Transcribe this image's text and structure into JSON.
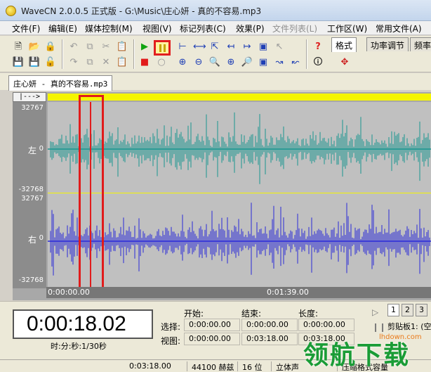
{
  "window": {
    "title": "WaveCN 2.0.0.5 正式版 - G:\\Music\\庄心妍 - 真的不容易.mp3"
  },
  "menu": [
    {
      "label": "文件(F)",
      "enabled": true
    },
    {
      "label": "编辑(E)",
      "enabled": true
    },
    {
      "label": "媒体控制(M)",
      "enabled": true
    },
    {
      "label": "视图(V)",
      "enabled": true
    },
    {
      "label": "标记列表(C)",
      "enabled": true
    },
    {
      "label": "效果(P)",
      "enabled": true
    },
    {
      "label": "文件列表(L)",
      "enabled": false
    },
    {
      "label": "工作区(W)",
      "enabled": true
    },
    {
      "label": "常用文件(A)",
      "enabled": true
    }
  ],
  "panel_tabs": [
    {
      "label": "格式",
      "active": true
    },
    {
      "label": "功率调节",
      "active": false
    },
    {
      "label": "频率"
    }
  ],
  "document_tab": "庄心妍 - 真的不容易.mp3",
  "waveform": {
    "range_button": "|--->",
    "left_channel": {
      "label": "左",
      "zero": "0",
      "max": "32767",
      "min": "-32768"
    },
    "right_channel": {
      "label": "右",
      "zero": "0",
      "max": "32767",
      "min": "-32768"
    },
    "time_start": "0:00:00.00",
    "time_mid": "0:01:39.00",
    "playhead_time": "0:00:18.02",
    "colors": {
      "left": "#1a9690",
      "right": "#2a2ad8",
      "playhead": "#e11b1b",
      "highlight": "#f5f500"
    }
  },
  "position": {
    "display": "0:00:18.02",
    "unit_label": "时:分:秒:1/30秒"
  },
  "selection": {
    "headers": {
      "start": "开始:",
      "end": "结束:",
      "length": "长度:"
    },
    "select_label": "选择:",
    "view_label": "视图:",
    "select": {
      "start": "0:00:00.00",
      "end": "0:00:00.00",
      "length": "0:00:00.00"
    },
    "view": {
      "start": "0:00:00.00",
      "end": "0:03:18.00",
      "length": "0:03:18.00"
    }
  },
  "clipboard": {
    "tabs": [
      "1",
      "2",
      "3"
    ],
    "label": "剪贴板1: (空"
  },
  "status": {
    "duration": "0:03:18.00",
    "samplerate": "44100 赫兹",
    "bits": "16 位",
    "channels": "立体声",
    "extra": "压缩格式容量"
  },
  "watermark": {
    "text": "领航下载",
    "site": "lhdown.com"
  }
}
